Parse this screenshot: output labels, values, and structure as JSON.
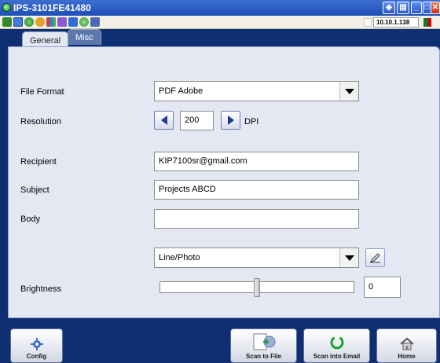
{
  "window": {
    "title": "IPS-3101FE41480",
    "controls": [
      "restore",
      "menu",
      "minimize",
      "maximize",
      "close"
    ]
  },
  "toolbar": {
    "icons": [
      "network-icon",
      "window-icon",
      "globe-icon",
      "sync-icon",
      "chart-icon",
      "graph-icon",
      "device-icon",
      "gear-globe-icon",
      "brush-icon"
    ],
    "ip_address": "10.10.1.138",
    "status_colors": [
      "#1b7a1b",
      "#b81414"
    ]
  },
  "tabs": [
    {
      "label": "General",
      "active": true
    },
    {
      "label": "Misc",
      "active": false
    }
  ],
  "form": {
    "file_format": {
      "label": "File Format",
      "value": "PDF Adobe"
    },
    "resolution": {
      "label": "Resolution",
      "value": "200",
      "unit": "DPI"
    },
    "recipient": {
      "label": "Recipient",
      "value": "KIP7100sr@gmail.com"
    },
    "subject": {
      "label": "Subject",
      "value": "Projects ABCD"
    },
    "body": {
      "label": "Body",
      "value": ""
    },
    "mode": {
      "value": "Line/Photo"
    },
    "brightness": {
      "label": "Brightness",
      "value": "0",
      "slider_level": 0.5
    }
  },
  "buttons": {
    "config": "Config",
    "scan_to_file": "Scan to File",
    "scan_into_email": "Scan into Email",
    "home": "Home"
  },
  "colors": {
    "title_bar": "#2d5fc8",
    "background": "#0f2f73",
    "panel": "#e4e8f3",
    "accent_green": "#17a334"
  }
}
